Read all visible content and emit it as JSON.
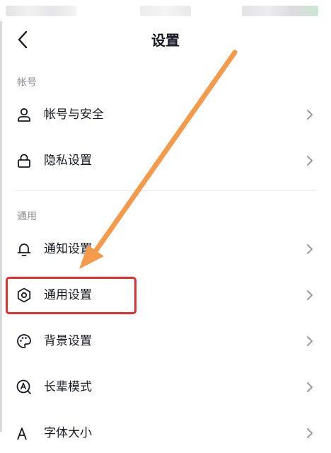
{
  "header": {
    "title": "设置"
  },
  "sections": {
    "account": {
      "label": "帐号",
      "items": [
        {
          "label": "帐号与安全",
          "icon": "person-icon"
        },
        {
          "label": "隐私设置",
          "icon": "lock-icon"
        }
      ]
    },
    "general": {
      "label": "通用",
      "items": [
        {
          "label": "通知设置",
          "icon": "bell-icon"
        },
        {
          "label": "通用设置",
          "icon": "gear-icon"
        },
        {
          "label": "背景设置",
          "icon": "palette-icon"
        },
        {
          "label": "长辈模式",
          "icon": "elder-mode-icon"
        },
        {
          "label": "字体大小",
          "icon": "font-size-icon"
        }
      ]
    }
  },
  "annotation": {
    "highlight_color": "#e03131",
    "arrow_color": "#f39a4b"
  }
}
